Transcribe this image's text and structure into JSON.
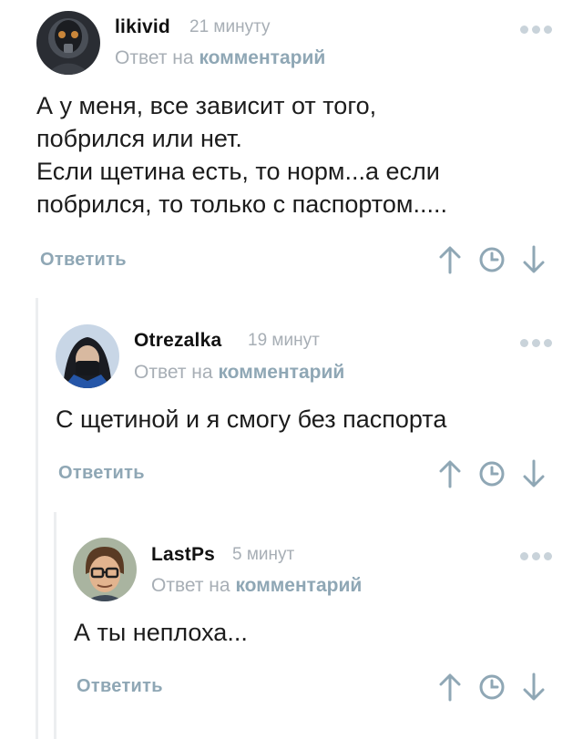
{
  "comments": [
    {
      "username": "likivid",
      "time": "21 минуту",
      "reply_prefix": "Ответ на",
      "reply_link": "комментарий",
      "text": "А у меня, все зависит от того,\nпобрился или нет.\nЕсли щетина есть, то норм...а если\nпобрился, то только с паспортом.....",
      "reply_label": "Ответить",
      "avatar_icon": "masked-figure-avatar"
    },
    {
      "username": "Otrezalka",
      "time": "19 минут",
      "reply_prefix": "Ответ на",
      "reply_link": "комментарий",
      "text": "С щетиной и я смогу без паспорта",
      "reply_label": "Ответить",
      "avatar_icon": "hooded-person-avatar"
    },
    {
      "username": "LastPs",
      "time": "5 минут",
      "reply_prefix": "Ответ на",
      "reply_link": "комментарий",
      "text": "А ты неплоха...",
      "reply_label": "Ответить",
      "avatar_icon": "cartoon-man-glasses-avatar"
    }
  ],
  "icons": {
    "more": "more-dots-icon",
    "upvote": "arrow-up-icon",
    "save": "clock-icon",
    "downvote": "arrow-down-icon"
  },
  "colors": {
    "username": "#111111",
    "muted": "#a7aeb5",
    "link": "#8fa7b5",
    "dots": "#c9d3da",
    "thread_line": "#eceef0"
  }
}
